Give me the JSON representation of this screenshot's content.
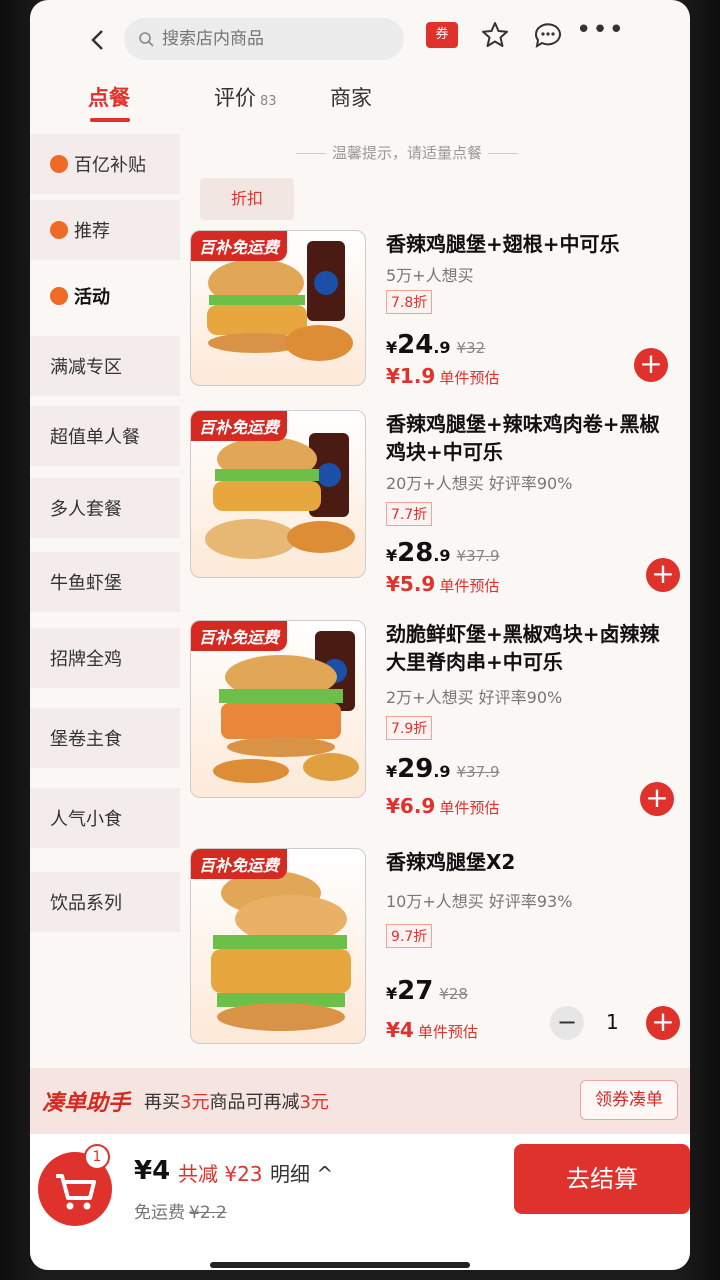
{
  "search": {
    "placeholder": "搜索店内商品"
  },
  "header": {
    "coupon_label": "券"
  },
  "tabs": [
    {
      "label": "点餐",
      "count": ""
    },
    {
      "label": "评价",
      "count": "83"
    },
    {
      "label": "商家",
      "count": ""
    }
  ],
  "tip": "温馨提示，请适量点餐",
  "filter_chip": "折扣",
  "sidebar": {
    "items": [
      {
        "label": "百亿补贴"
      },
      {
        "label": "推荐"
      },
      {
        "label": "活动"
      },
      {
        "label": "满减专区"
      },
      {
        "label": "超值单人餐"
      },
      {
        "label": "多人套餐"
      },
      {
        "label": "牛鱼虾堡"
      },
      {
        "label": "招牌全鸡"
      },
      {
        "label": "堡卷主食"
      },
      {
        "label": "人气小食"
      },
      {
        "label": "饮品系列"
      }
    ]
  },
  "products": [
    {
      "badge": "百补免运费",
      "title": "香辣鸡腿堡+翅根+中可乐",
      "sales": "5万+人想买",
      "discount": "7.8折",
      "currency": "¥",
      "price_int": "24",
      "price_dec": ".9",
      "old_price": "¥32",
      "est_currency": "¥",
      "est_price": "1.9",
      "est_label": "单件预估"
    },
    {
      "badge": "百补免运费",
      "title": "香辣鸡腿堡+辣味鸡肉卷+黑椒鸡块+中可乐",
      "sales": "20万+人想买 好评率90%",
      "discount": "7.7折",
      "currency": "¥",
      "price_int": "28",
      "price_dec": ".9",
      "old_price": "¥37.9",
      "est_currency": "¥",
      "est_price": "5.9",
      "est_label": "单件预估"
    },
    {
      "badge": "百补免运费",
      "title": "劲脆鲜虾堡+黑椒鸡块+卤辣辣大里脊肉串+中可乐",
      "sales": "2万+人想买 好评率90%",
      "discount": "7.9折",
      "currency": "¥",
      "price_int": "29",
      "price_dec": ".9",
      "old_price": "¥37.9",
      "est_currency": "¥",
      "est_price": "6.9",
      "est_label": "单件预估"
    },
    {
      "badge": "百补免运费",
      "title": "香辣鸡腿堡X2",
      "sales": "10万+人想买 好评率93%",
      "discount": "9.7折",
      "currency": "¥",
      "price_int": "27",
      "price_dec": "",
      "old_price": "¥28",
      "est_currency": "¥",
      "est_price": "4",
      "est_label": "单件预估",
      "quantity": "1"
    }
  ],
  "helper": {
    "title": "凑单助手",
    "text_a": "再买",
    "text_b": "3元",
    "text_c": "商品可再减",
    "text_d": "3元",
    "button": "领券凑单"
  },
  "checkout": {
    "cart_count": "1",
    "total": "¥4",
    "saved": "共减 ¥23",
    "detail": "明细 ^",
    "shipping_label": "免运费",
    "shipping_old": "¥2.2",
    "button": "去结算"
  },
  "colors": {
    "accent": "#e0322c",
    "badge": "#d42a22"
  }
}
